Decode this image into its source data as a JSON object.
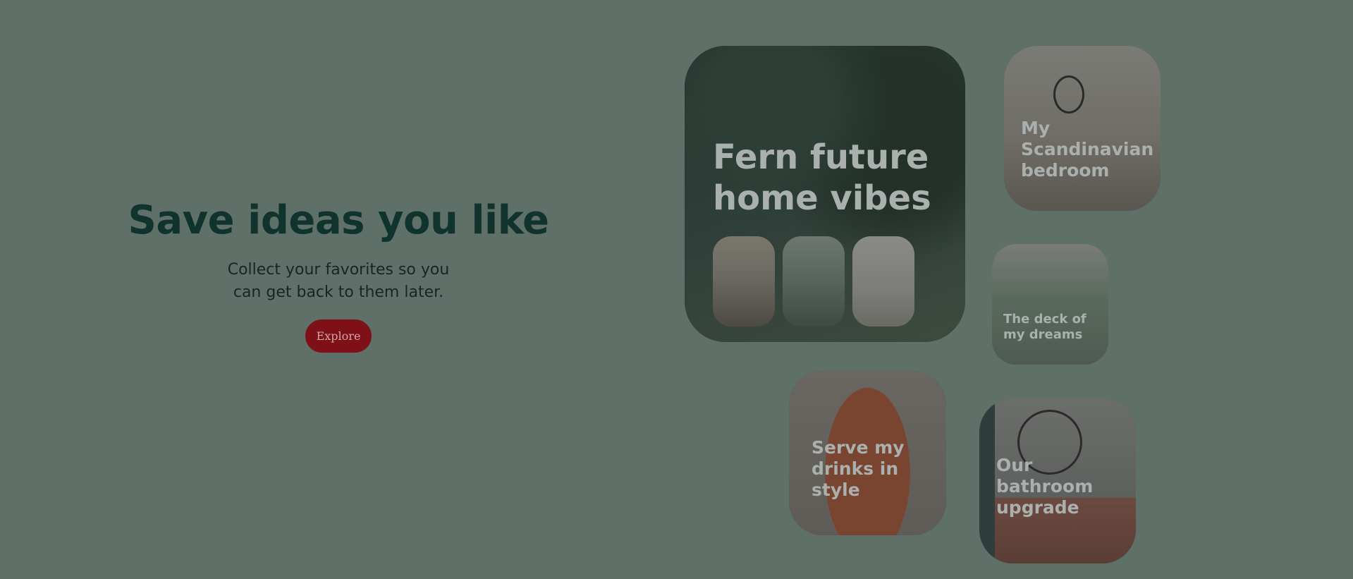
{
  "hero": {
    "title": "Save ideas you like",
    "subtitle": "Collect your favorites so you can get back to them later.",
    "cta_label": "Explore"
  },
  "boards": [
    {
      "title": "Fern future home vibes"
    },
    {
      "title": "My Scandinavian bedroom"
    },
    {
      "title": "The deck of my dreams"
    },
    {
      "title": "Serve my drinks in style"
    },
    {
      "title": "Our bathroom upgrade"
    }
  ],
  "colors": {
    "background": "#5e7068",
    "title": "#11332d",
    "cta_bg": "#7f1018",
    "card_label": "#a9b0ad"
  }
}
